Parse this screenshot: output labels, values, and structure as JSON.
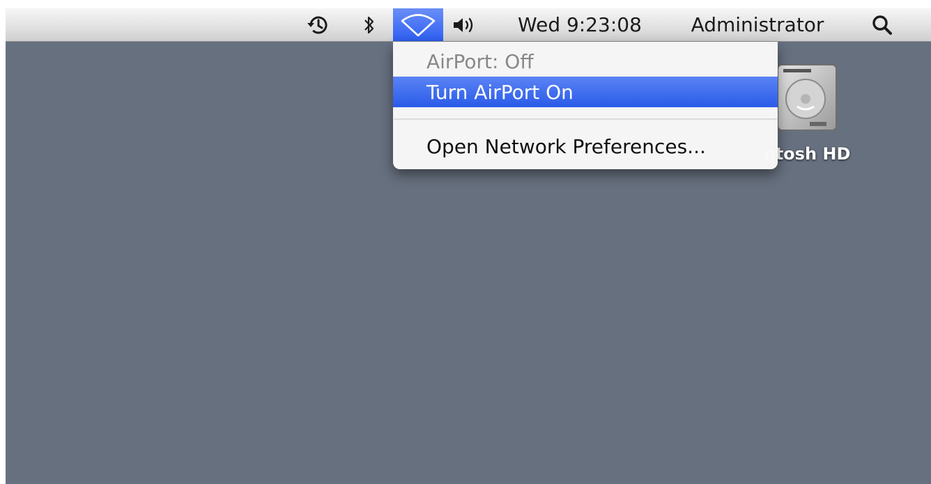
{
  "menubar": {
    "clock": "Wed 9:23:08",
    "user": "Administrator",
    "icons": {
      "time_machine": "time-machine-icon",
      "bluetooth": "bluetooth-icon",
      "airport": "wifi-icon",
      "volume": "volume-icon",
      "spotlight": "search-icon"
    }
  },
  "airport_menu": {
    "status": "AirPort: Off",
    "items": [
      {
        "label": "Turn AirPort On",
        "highlighted": true
      },
      {
        "label": "Open Network Preferences...",
        "highlighted": false
      }
    ]
  },
  "desktop": {
    "drive_label": "ntosh HD"
  },
  "colors": {
    "desktop": "#67707f",
    "highlight": "#2a5be8",
    "menubar": "#e2e2e2"
  }
}
